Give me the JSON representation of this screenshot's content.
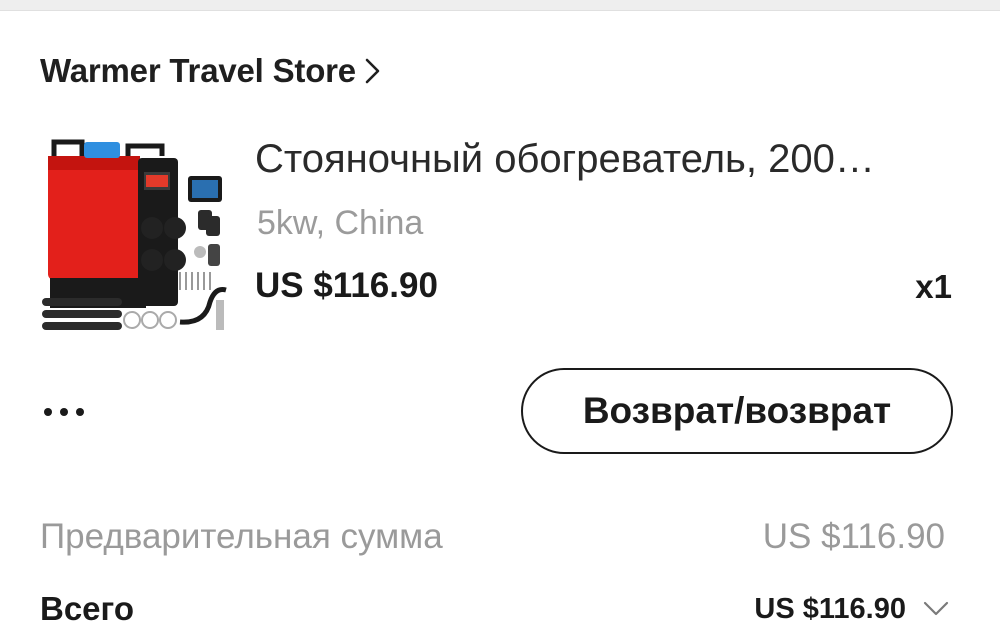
{
  "store": {
    "name": "Warmer Travel Store",
    "chevron_icon": "chevron-right-icon"
  },
  "product": {
    "title": "Стояночный обогреватель, 200…",
    "variant": "5kw, China",
    "price": "US $116.90",
    "quantity": "x1",
    "image_icon": "parking-heater-product-image",
    "image_colors": {
      "body": "#e3201b",
      "panel": "#1a1a1a",
      "tank": "#2f8fe0"
    }
  },
  "actions": {
    "more_icon": "more-dots-icon",
    "return_label": "Возврат/возврат"
  },
  "summary": {
    "subtotal_label": "Предварительная сумма",
    "subtotal_value": "US $116.90",
    "total_label": "Всего",
    "total_value": "US $116.90",
    "expand_icon": "chevron-down-icon"
  }
}
